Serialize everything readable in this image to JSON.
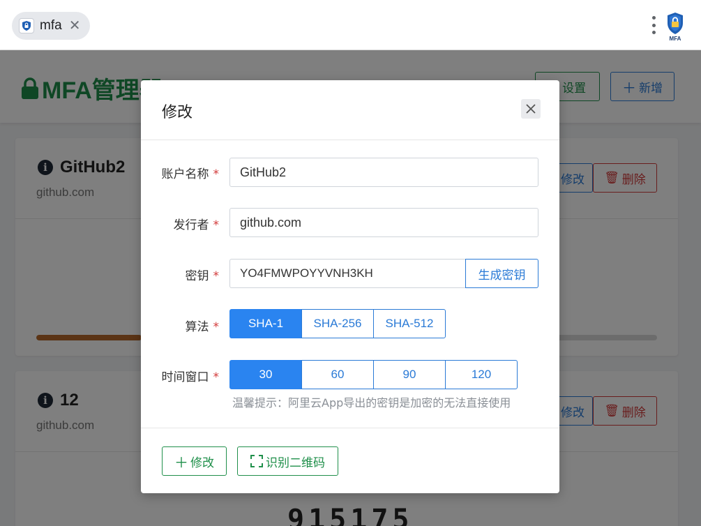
{
  "browser": {
    "tab_title": "mfa",
    "tab_close": "✕",
    "extension_icon_label": "MFA",
    "favicon_label": "MFA"
  },
  "app": {
    "title": "MFA管理器",
    "settings_label": "设置",
    "add_label": "新增"
  },
  "accounts": [
    {
      "name": "GitHub2",
      "issuer": "github.com",
      "edit_label": "修改",
      "delete_label": "删除",
      "progress": 0.17
    },
    {
      "name": "12",
      "issuer": "github.com",
      "edit_label": "修改",
      "delete_label": "删除",
      "code": "915175"
    }
  ],
  "modal": {
    "title": "修改",
    "fields": {
      "account_name": {
        "label": "账户名称",
        "value": "GitHub2"
      },
      "issuer": {
        "label": "发行者",
        "value": "github.com"
      },
      "secret": {
        "label": "密钥",
        "value": "YO4FMWPOYYVNH3KH",
        "generate_label": "生成密钥"
      },
      "algorithm": {
        "label": "算法",
        "options": [
          "SHA-1",
          "SHA-256",
          "SHA-512"
        ],
        "selected": "SHA-1"
      },
      "period": {
        "label": "时间窗口",
        "options": [
          "30",
          "60",
          "90",
          "120"
        ],
        "selected": "30"
      }
    },
    "required_mark": "*",
    "hint": "温馨提示：阿里云App导出的密钥是加密的无法直接使用",
    "footer": {
      "edit_label": "修改",
      "scan_label": "识别二维码"
    }
  },
  "colors": {
    "brand_green": "#1f8f4a",
    "primary_blue": "#2a7ad6",
    "danger_red": "#d23b3b",
    "progress_orange": "#b6692a"
  }
}
